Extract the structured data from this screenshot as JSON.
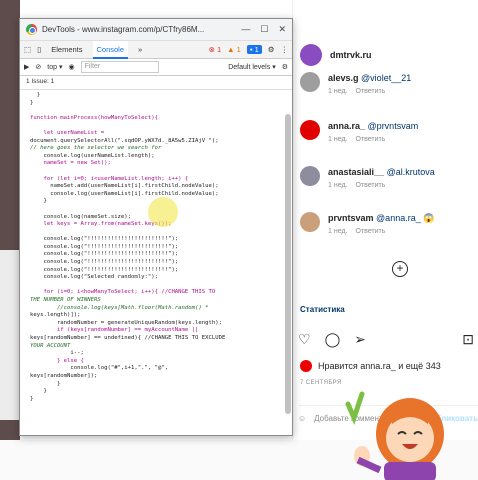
{
  "devtools": {
    "title": "DevTools - www.instagram.com/p/CTfry86M...",
    "tabs": [
      "Elements",
      "Console",
      "»"
    ],
    "active_tab": "Console",
    "error_count": "1",
    "warning_count": "1",
    "info_count": "1",
    "context": "top",
    "filter_placeholder": "Filter",
    "levels": "Default levels",
    "issues": "1 Issue: 1",
    "code_lines": [
      "  }",
      "}",
      "",
      "function mainProcess(howManyToSelect){",
      "",
      "    let userNameList =",
      "document.querySelectorAll(\".sqdOP.yWX7d._8A5w5.ZIAjV \");",
      "// here goes the selector we search for",
      "    console.log(userNameList.length);",
      "    nameSet = new Set();",
      "",
      "    for (let i=0; i<userNameList.length; i++) {",
      "      nameSet.add(userNameList[i].firstChild.nodeValue);",
      "      console.log(userNameList[i].firstChild.nodeValue);",
      "    }",
      "",
      "    console.log(nameSet.size);",
      "    let keys = Array.from(nameSet.keys());",
      "",
      "    console.log(\"!!!!!!!!!!!!!!!!!!!!!!!!\");",
      "    console.log(\"!!!!!!!!!!!!!!!!!!!!!!!!\");",
      "    console.log(\"!!!!!!!!!!!!!!!!!!!!!!!!\");",
      "    console.log(\"!!!!!!!!!!!!!!!!!!!!!!!!\");",
      "    console.log(\"!!!!!!!!!!!!!!!!!!!!!!!!\");",
      "    console.log(\"Selected randomly:\");",
      "",
      "    for (i=0; i<howManyToSelect; i++){ //CHANGE THIS TO",
      "THE NUMBER OF WINNERS",
      "        //console.log(keys[Math.floor(Math.random() *",
      "keys.length)]);",
      "        randomNumber = generateUniqueRandom(keys.length);",
      "        if (keys[randomNumber] == myAccountName ||",
      "keys[randomNumber] == undefined){ //CHANGE THIS TO EXCLUDE",
      "YOUR ACCOUNT",
      "            i--;",
      "        } else {",
      "            console.log(\"#\",i+1,\".\", \"@\",",
      "keys[randomNumber]);",
      "        }",
      "    }",
      "}"
    ]
  },
  "instagram": {
    "post_author": "dmtrvk.ru",
    "comments": [
      {
        "user": "alevs.g",
        "text": "@violet__21",
        "time": "1 нед.",
        "reply": "Ответить",
        "avatar_color": "#9e9e9e"
      },
      {
        "user": "anna.ra_",
        "text": "@prvntsvam",
        "time": "1 нед.",
        "reply": "Ответить",
        "avatar_color": "#e00000"
      },
      {
        "user": "anastasiali__",
        "text": "@al.krutova",
        "time": "1 нед.",
        "reply": "Ответить",
        "avatar_color": "#8d8d9e"
      },
      {
        "user": "prvntsvam",
        "text": "@anna.ra_ 😱",
        "time": "1 нед.",
        "reply": "Ответить",
        "avatar_color": "#c9a07a"
      }
    ],
    "stats_link": "Статистика",
    "likes_text": "Нравится anna.ra_ и ещё 343",
    "date": "7 СЕНТЯБРЯ",
    "add_comment_placeholder": "Добавьте комментарий...",
    "publish": "Опубликовать"
  }
}
